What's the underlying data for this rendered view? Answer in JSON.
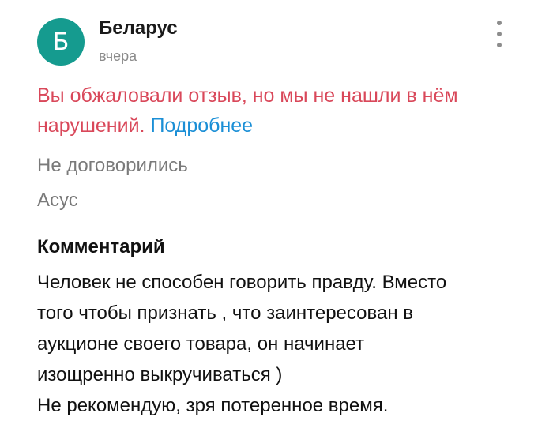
{
  "review": {
    "avatar_letter": "Б",
    "avatar_color": "#159b8f",
    "author": "Беларус",
    "date": "вчера",
    "menu_icon": "more-vertical-icon"
  },
  "appeal": {
    "message": "Вы обжаловали отзыв, но мы не нашли в нём нарушений.",
    "link_label": "Подробнее",
    "message_color": "#d9485a",
    "link_color": "#1b8fd6"
  },
  "deal": {
    "status": "Не договорились",
    "product": "Асус"
  },
  "comment": {
    "heading": "Комментарий",
    "lines": [
      "Человек не способен говорить правду. Вместо",
      "того чтобы признать , что заинтересован в",
      "аукционе своего товара, он начинает",
      "изощренно выкручиваться )",
      "Не рекомендую, зря потеренное время."
    ]
  }
}
